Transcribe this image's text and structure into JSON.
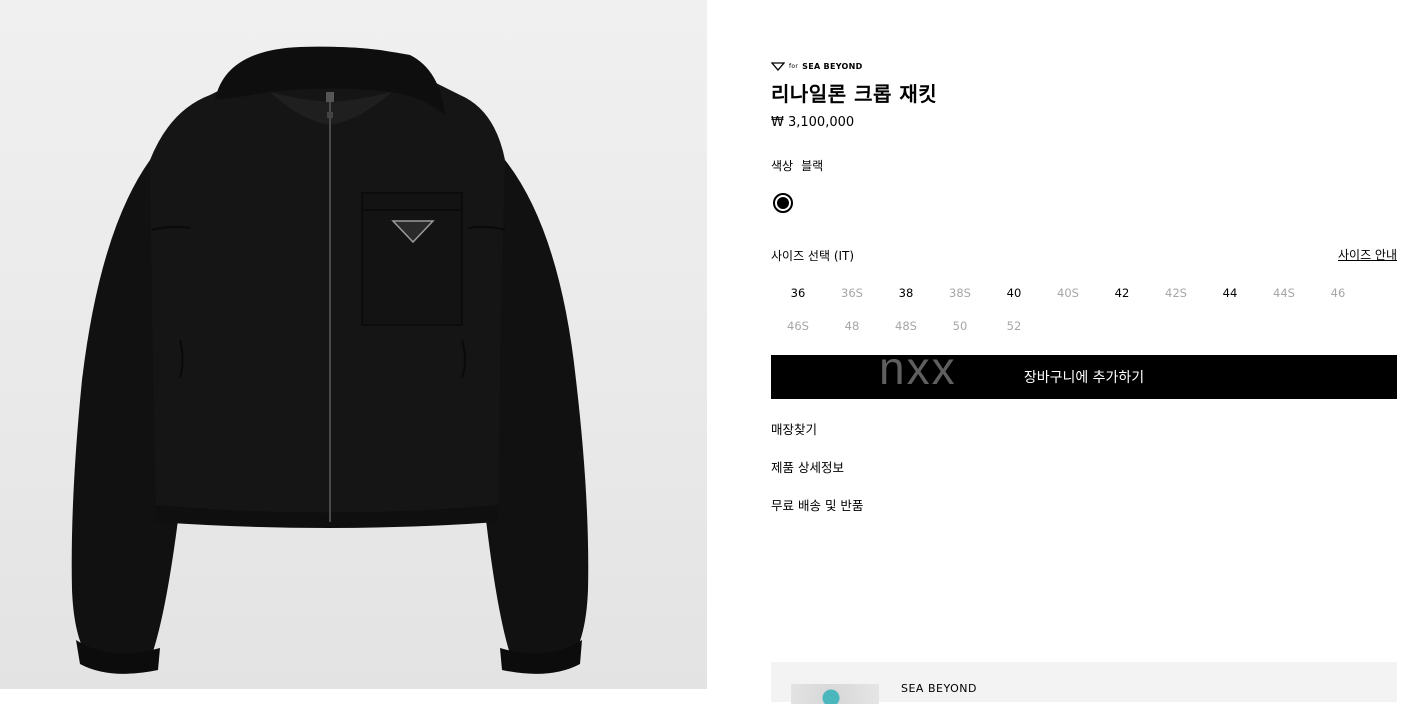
{
  "product": {
    "brand_prefix": "for",
    "brand": "SEA BEYOND",
    "title": "리나일론 크롭 재킷",
    "price": "₩ 3,100,000",
    "badge_text": "PRADA"
  },
  "color": {
    "label": "색상",
    "value": "블랙",
    "swatch": "#000000"
  },
  "size": {
    "label": "사이즈 선택 (IT)",
    "guide": "사이즈 안내",
    "options": [
      {
        "label": "36",
        "available": true
      },
      {
        "label": "36S",
        "available": false
      },
      {
        "label": "38",
        "available": true
      },
      {
        "label": "38S",
        "available": false
      },
      {
        "label": "40",
        "available": true
      },
      {
        "label": "40S",
        "available": false
      },
      {
        "label": "42",
        "available": true
      },
      {
        "label": "42S",
        "available": false
      },
      {
        "label": "44",
        "available": true
      },
      {
        "label": "44S",
        "available": false
      },
      {
        "label": "46",
        "available": false
      },
      {
        "label": "46S",
        "available": false
      },
      {
        "label": "48",
        "available": false
      },
      {
        "label": "48S",
        "available": false
      },
      {
        "label": "50",
        "available": false
      },
      {
        "label": "52",
        "available": false
      }
    ]
  },
  "actions": {
    "add_to_cart": "장바구니에 추가하기",
    "overlay_text": "nxx"
  },
  "links": {
    "store": "매장찾기",
    "details": "제품 상세정보",
    "shipping": "무료 배송 및 반품"
  },
  "promo": {
    "title": "SEA BEYOND"
  },
  "colors": {
    "accent": "#000000",
    "unavailable": "#a6a6a6",
    "hero_bg": "#ebebeb"
  }
}
